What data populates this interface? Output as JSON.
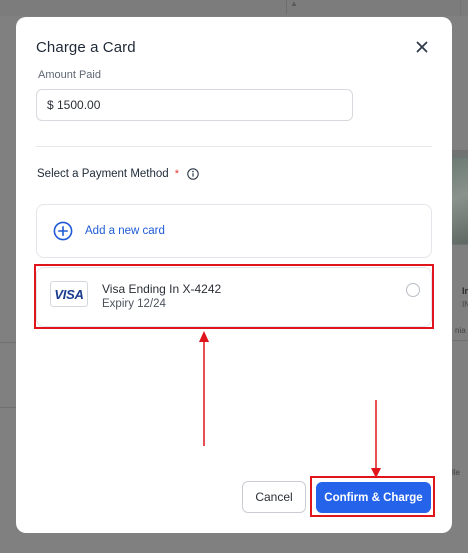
{
  "modal": {
    "title": "Charge a Card",
    "amount_label": "Amount Paid",
    "amount_value": "$ 1500.00",
    "payment_method_label": "Select a Payment Method",
    "required_mark": "*",
    "add_card_label": "Add a new card",
    "saved_card": {
      "brand": "VISA",
      "name": "Visa Ending In X-4242",
      "expiry": "Expiry 12/24",
      "selected": false
    },
    "cancel_label": "Cancel",
    "confirm_label": "Confirm & Charge"
  },
  "background": {
    "text_1": "In",
    "text_2": "IN",
    "text_3": "nia",
    "text_4": "lle"
  },
  "colors": {
    "primary": "#2563eb",
    "link": "#1f5bd6",
    "required": "#e53935",
    "annotation": "#e0141b",
    "overlay": "#808080"
  },
  "icons": {
    "close": "close-icon",
    "info": "info-icon",
    "add": "plus-circle-icon",
    "card_brand": "visa-logo"
  }
}
